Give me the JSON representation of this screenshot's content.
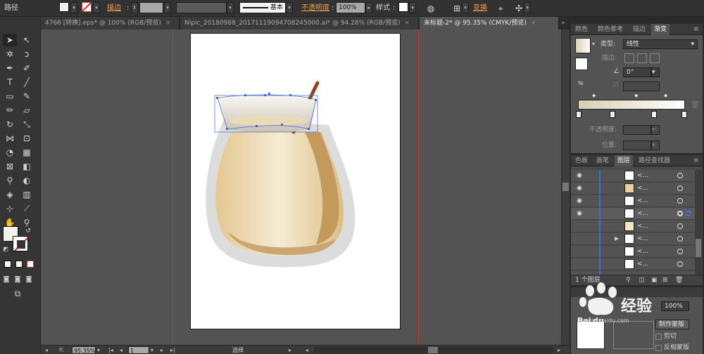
{
  "toolbar": {
    "path_label": "路径",
    "stroke_label": "描边",
    "stroke_style": "基本",
    "opacity_label": "不透明度",
    "opacity_value": "100%",
    "style_label": "样式",
    "transform_label": "变换"
  },
  "tabs": [
    {
      "label": "4766 [转换].eps* @ 100% (RGB/预览)"
    },
    {
      "label": "Nipic_20180988_20171119094708245000.ai* @ 94.28% (RGB/预览)"
    },
    {
      "label": "未标题-2* @ 95.35% (CMYK/预览)"
    }
  ],
  "status": {
    "zoom": "95.35%",
    "page": "1",
    "mode": "选择"
  },
  "panel_top": {
    "tabs": [
      "颜色",
      "颜色参考",
      "描边",
      "渐变"
    ],
    "type_label": "类型:",
    "type_value": "线性",
    "stroke_label": "描边:",
    "angle_value": "0°",
    "opacity_label": "不透明度:",
    "position_label": "位置:"
  },
  "panel_layers": {
    "tabs": [
      "色板",
      "画笔",
      "图层",
      "路径查找器"
    ],
    "rows": [
      {
        "name": "<...",
        "visible": true
      },
      {
        "name": "<...",
        "visible": true
      },
      {
        "name": "<...",
        "visible": true
      },
      {
        "name": "<...",
        "visible": true
      },
      {
        "name": "<...",
        "visible": false
      },
      {
        "name": "<...",
        "visible": false
      },
      {
        "name": "<...",
        "visible": false
      },
      {
        "name": "<...",
        "visible": false
      },
      {
        "name": "<...",
        "visible": false
      }
    ],
    "footer": "1 个图层"
  },
  "panel_bottom": {
    "opacity_value": "100%",
    "mask_button": "制作蒙版",
    "clip_label": "剪切",
    "invert_label": "反相蒙版"
  },
  "watermark": {
    "text": "经验",
    "sub": "jingyan.baidu.com"
  },
  "colors": {
    "gradient_start": "#dcd3b8",
    "gradient_end": "#ffffff",
    "cup_body": "#e9d6a8",
    "cup_shadow": "#c49a5c",
    "stick": "#8a4a1e"
  }
}
